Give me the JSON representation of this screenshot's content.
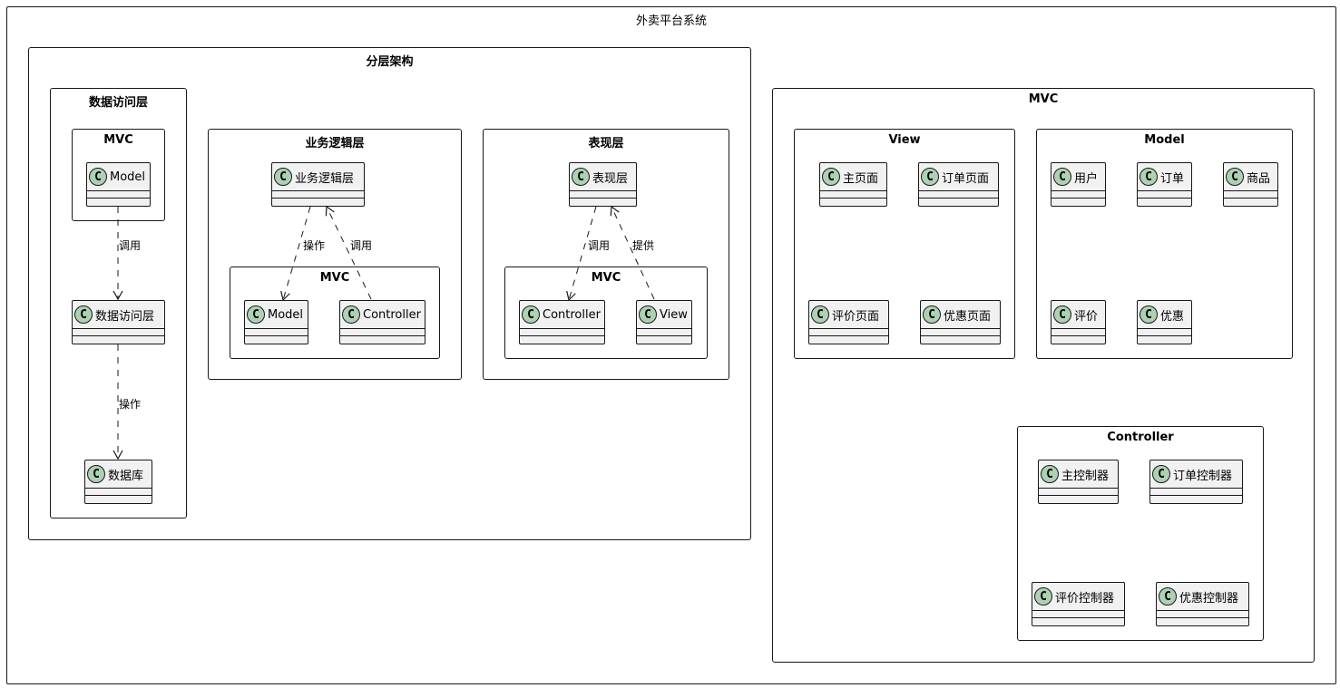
{
  "diagram": {
    "system_title": "外卖平台系统",
    "layered_title": "分层架构",
    "data_layer_title": "数据访问层",
    "data_mvc_title": "MVC",
    "business_layer_title": "业务逻辑层",
    "business_mvc_title": "MVC",
    "presentation_layer_title": "表现层",
    "presentation_mvc_title": "MVC",
    "mvc_title": "MVC",
    "view_title": "View",
    "model_title": "Model",
    "controller_title": "Controller",
    "circle_letter": "C"
  },
  "classes": {
    "data_model": "Model",
    "data_access": "数据访问层",
    "database": "数据库",
    "business": "业务逻辑层",
    "business_model": "Model",
    "business_controller": "Controller",
    "presentation": "表现层",
    "presentation_controller": "Controller",
    "presentation_view": "View",
    "main_page": "主页面",
    "order_page": "订单页面",
    "review_page": "评价页面",
    "promo_page": "优惠页面",
    "user": "用户",
    "order": "订单",
    "product": "商品",
    "review": "评价",
    "promo": "优惠",
    "main_controller": "主控制器",
    "order_controller": "订单控制器",
    "review_controller": "评价控制器",
    "promo_controller": "优惠控制器"
  },
  "edges": {
    "data_call": "调用",
    "data_operate": "操作",
    "business_operate": "操作",
    "business_call": "调用",
    "presentation_call": "调用",
    "presentation_provide": "提供"
  },
  "colors": {
    "class_fill": "#f1f1f1",
    "class_icon": "#add1b2",
    "border": "#181818"
  }
}
